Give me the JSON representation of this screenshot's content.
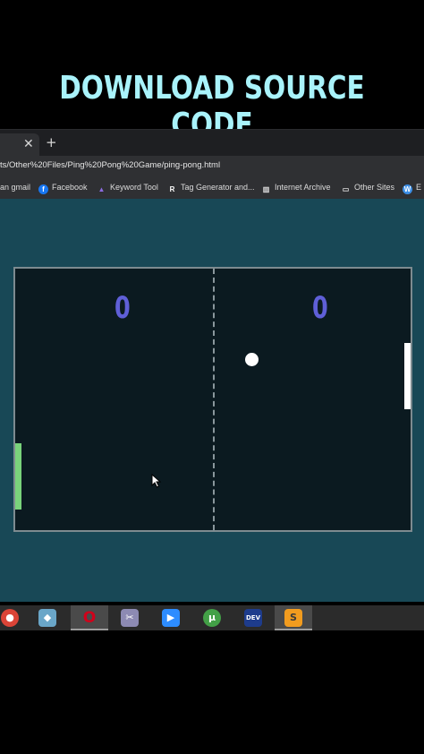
{
  "banner": {
    "title": "DOWNLOAD SOURCE CODE"
  },
  "browser": {
    "tab": {
      "close_glyph": "✕",
      "new_tab_glyph": "+"
    },
    "url": "ts/Other%20Files/Ping%20Pong%20Game/ping-pong.html",
    "bookmarks": [
      {
        "label": "an gmail",
        "icon": "none"
      },
      {
        "label": "Facebook",
        "icon": "facebook-icon",
        "glyph": "f",
        "color": "#1877f2"
      },
      {
        "label": "Keyword Tool",
        "icon": "keyword-tool-icon",
        "glyph": "▲",
        "color": "#6a4bc4"
      },
      {
        "label": "Tag Generator and...",
        "icon": "r-icon",
        "glyph": "R",
        "color": "transparent"
      },
      {
        "label": "Internet Archive",
        "icon": "archive-icon",
        "glyph": "▥",
        "color": "transparent"
      },
      {
        "label": "Other Sites",
        "icon": "folder-icon",
        "glyph": "▭",
        "color": "transparent"
      },
      {
        "label": "E",
        "icon": "wordpress-icon",
        "glyph": "W",
        "color": "#3c8ee6"
      }
    ]
  },
  "game": {
    "left_score": "0",
    "right_score": "0"
  },
  "taskbar": {
    "apps": [
      {
        "name": "chrome-icon",
        "glyph": "●",
        "color": "#db4437"
      },
      {
        "name": "notes-icon",
        "glyph": "◆",
        "color": "#6aa6c8"
      },
      {
        "name": "opera-icon",
        "glyph": "O",
        "color": "#d0021b"
      },
      {
        "name": "snipping-tool-icon",
        "glyph": "✂",
        "color": "#8d8ab3"
      },
      {
        "name": "zoom-icon",
        "glyph": "▶",
        "color": "#2d8cff"
      },
      {
        "name": "utorrent-icon",
        "glyph": "µ",
        "color": "#43a047"
      },
      {
        "name": "devcpp-icon",
        "glyph": "DEV",
        "color": "#1e3c8c"
      },
      {
        "name": "sublime-text-icon",
        "glyph": "S",
        "color": "#f29c1f"
      }
    ]
  },
  "colors": {
    "banner_text": "#a9f3fb",
    "page_bg": "#184856",
    "board_bg": "#0b1a20",
    "score": "#5f5fd7",
    "left_paddle": "#79d37b",
    "right_paddle": "#ffffff"
  }
}
